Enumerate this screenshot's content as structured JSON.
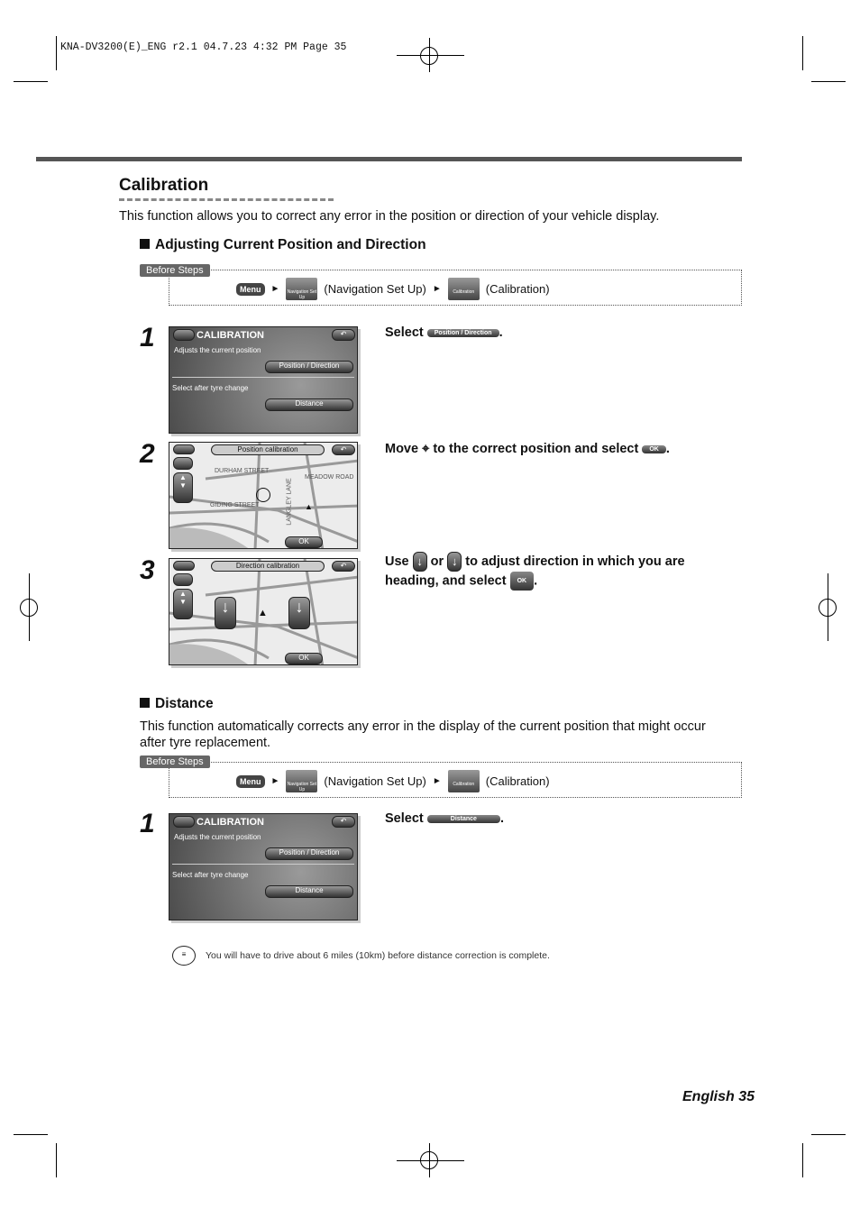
{
  "print_header": "KNA-DV3200(E)_ENG r2.1   04.7.23   4:32 PM   Page 35",
  "title": "Calibration",
  "intro": "This function allows you to correct any error in the position or direction of your vehicle display.",
  "section1": {
    "heading": "Adjusting Current Position and Direction"
  },
  "before_steps": {
    "label": "Before Steps",
    "menu": "Menu",
    "nav_icon": "Navigation Set Up",
    "nav_text": "(Navigation Set Up)",
    "cal_icon": "Calibration",
    "cal_text": "(Calibration)"
  },
  "screen_cal": {
    "title": "CALIBRATION",
    "line1": "Adjusts the current position",
    "btn1": "Position / Direction",
    "line2": "Select after tyre change",
    "btn2": "Distance"
  },
  "screen_pos": {
    "title": "Position calibration",
    "ok": "OK",
    "streets": [
      "DURHAM STREET",
      "GIDING STREET",
      "MEADOW ROAD",
      "LANGLEY LANE"
    ]
  },
  "screen_dir": {
    "title": "Direction calibration",
    "ok": "OK"
  },
  "steps": [
    {
      "num": "1",
      "pre": "Select",
      "btn": "Position / Direction",
      "post": "."
    },
    {
      "num": "2",
      "pre": "Move",
      "mid": "to the correct position and select",
      "btn": "OK",
      "post": "."
    },
    {
      "num": "3",
      "pre": "Use",
      "or": "or",
      "mid": "to adjust direction in which you are",
      "line2": "heading, and select",
      "btn": "OK",
      "post": "."
    }
  ],
  "section2": {
    "heading": "Distance",
    "text": "This function automatically corrects any error in the display of the current position that might occur after tyre replacement.",
    "step": {
      "num": "1",
      "pre": "Select",
      "btn": "Distance",
      "post": "."
    }
  },
  "note": "You will have to drive about 6 miles (10km) before distance correction is complete.",
  "footer": "English 35"
}
